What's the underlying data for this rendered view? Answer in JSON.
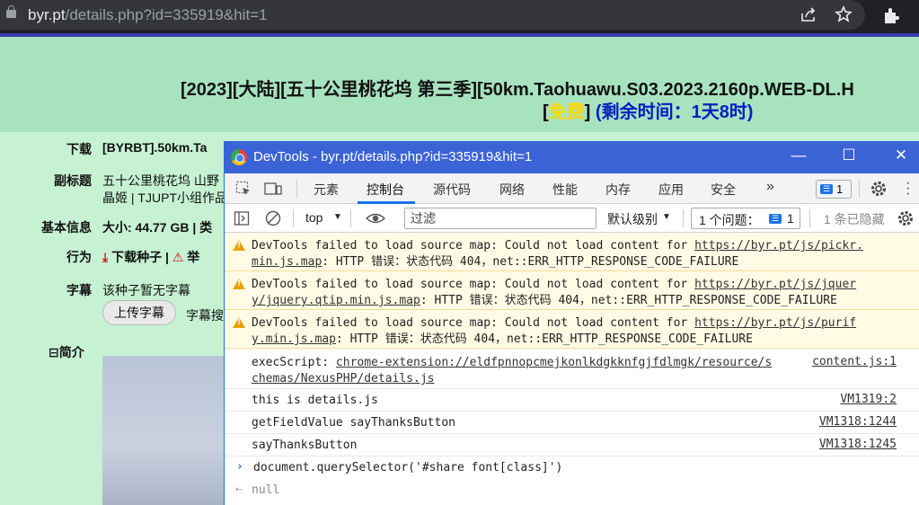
{
  "browser": {
    "url_host": "byr.pt",
    "url_path": "/details.php?id=335919&hit=1",
    "icons": [
      "lock-icon",
      "share-icon",
      "star-icon",
      "extension-icon"
    ]
  },
  "page": {
    "title": "[2023][大陆][五十公里桃花坞 第三季][50km.Taohuawu.S03.2023.2160p.WEB-DL.H",
    "free_bracket_open": "[",
    "free_label": "免费",
    "free_bracket_close": "]",
    "remaining": "(剩余时间：1天8时)",
    "rows": {
      "download_label": "下载",
      "download_value": "[BYRBT].50km.Ta",
      "subtitle_label": "副标题",
      "subtitle_line1": "五十公里桃花坞 山野",
      "subtitle_line2": "晶姬 | TJUPT小组作品",
      "info_label": "基本信息",
      "info_value": "大小: 44.77 GB  |  类",
      "action_label": "行为",
      "action_download": "下载种子",
      "action_sep": "|",
      "action_report": "举",
      "subs_label": "字幕",
      "subs_value": "该种子暂无字幕",
      "upload_button": "上传字幕",
      "subs_search": "字幕搜",
      "intro_toggle": "⊟",
      "intro_label": "简介"
    }
  },
  "devtools": {
    "title": "DevTools - byr.pt/details.php?id=335919&hit=1",
    "window_buttons": [
      "—",
      "☐",
      "✕"
    ],
    "tabs": [
      "元素",
      "控制台",
      "源代码",
      "网络",
      "性能",
      "内存",
      "应用",
      "安全",
      "»"
    ],
    "active_tab": "控制台",
    "issue_count": "1",
    "toolbar": {
      "context": "top",
      "filter_placeholder": "过滤",
      "level": "默认级别",
      "issues_label": "1 个问题：",
      "issues_count": "1",
      "hidden": "1 条已隐藏"
    },
    "messages": [
      {
        "prefix": "DevTools failed to load source map: Could not load content for ",
        "link_a": "https://byr.pt/js/pickr.",
        "link_b": "min.js.map",
        "suffix": ": HTTP 错误：状态代码 404，net::ERR_HTTP_RESPONSE_CODE_FAILURE"
      },
      {
        "prefix": "DevTools failed to load source map: Could not load content for ",
        "link_a": "https://byr.pt/js/jquer",
        "link_b": "y/jquery.qtip.min.js.map",
        "suffix": ": HTTP 错误：状态代码 404，net::ERR_HTTP_RESPONSE_CODE_FAILURE"
      },
      {
        "prefix": "DevTools failed to load source map: Could not load content for ",
        "link_a": "https://byr.pt/js/purif",
        "link_b": "y.min.js.map",
        "suffix": ": HTTP 错误：状态代码 404，net::ERR_HTTP_RESPONSE_CODE_FAILURE"
      }
    ],
    "exec": {
      "label": "execScript: ",
      "link_a": "chrome-extension://eldfpnnopcmejkonlkdgkknfgjfdlmgk/resource/s",
      "link_b": "chemas/NexusPHP/details.js",
      "src": "content.js:1"
    },
    "logs": [
      {
        "text": "this is details.js",
        "src": "VM1319:2"
      },
      {
        "text": "getFieldValue sayThanksButton",
        "src": "VM1318:1244"
      },
      {
        "text": "sayThanksButton",
        "src": "VM1318:1245"
      }
    ],
    "input": "document.querySelector('#share font[class]')",
    "result": "null"
  }
}
